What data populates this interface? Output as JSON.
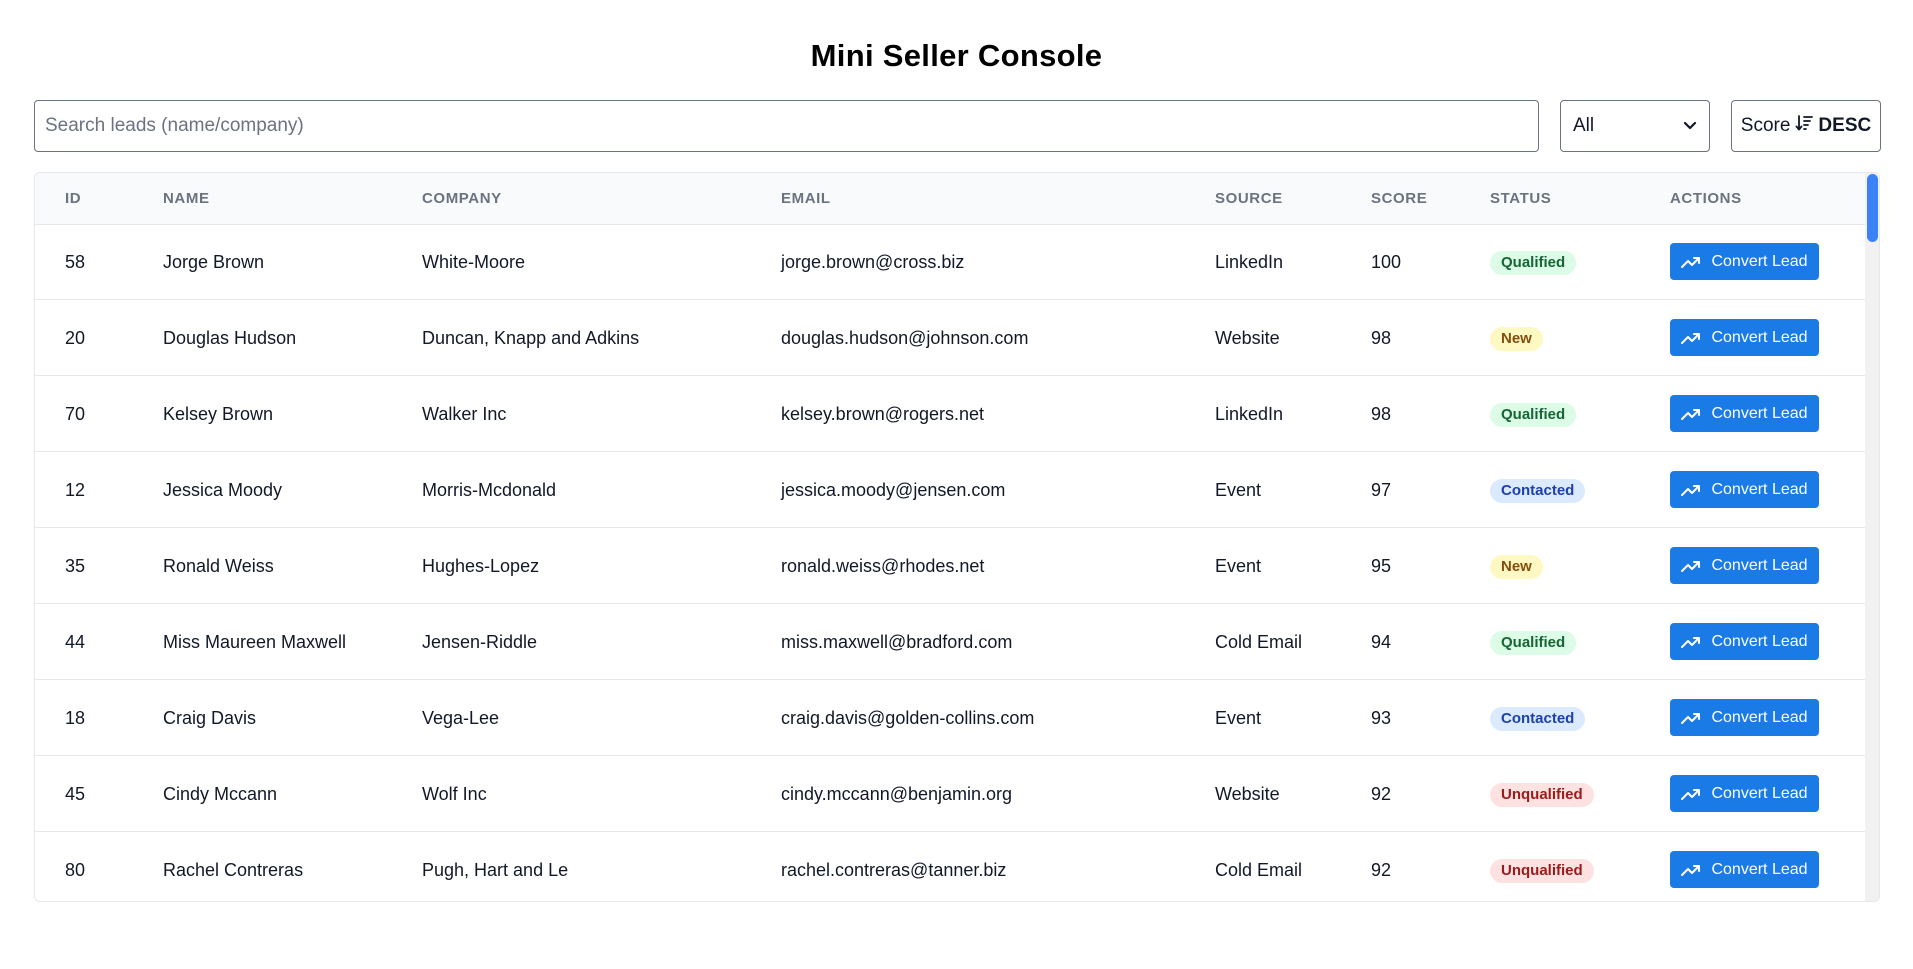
{
  "title": "Mini Seller Console",
  "toolbar": {
    "search_placeholder": "Search leads (name/company)",
    "search_value": "",
    "status_filter": "All",
    "sort_field": "Score",
    "sort_direction": "DESC"
  },
  "table": {
    "headers": [
      "ID",
      "NAME",
      "COMPANY",
      "EMAIL",
      "SOURCE",
      "SCORE",
      "STATUS",
      "ACTIONS"
    ],
    "action_label": "Convert Lead",
    "rows": [
      {
        "id": "58",
        "name": "Jorge Brown",
        "company": "White-Moore",
        "email": "jorge.brown@cross.biz",
        "source": "LinkedIn",
        "score": "100",
        "status": "Qualified"
      },
      {
        "id": "20",
        "name": "Douglas Hudson",
        "company": "Duncan, Knapp and Adkins",
        "email": "douglas.hudson@johnson.com",
        "source": "Website",
        "score": "98",
        "status": "New"
      },
      {
        "id": "70",
        "name": "Kelsey Brown",
        "company": "Walker Inc",
        "email": "kelsey.brown@rogers.net",
        "source": "LinkedIn",
        "score": "98",
        "status": "Qualified"
      },
      {
        "id": "12",
        "name": "Jessica Moody",
        "company": "Morris-Mcdonald",
        "email": "jessica.moody@jensen.com",
        "source": "Event",
        "score": "97",
        "status": "Contacted"
      },
      {
        "id": "35",
        "name": "Ronald Weiss",
        "company": "Hughes-Lopez",
        "email": "ronald.weiss@rhodes.net",
        "source": "Event",
        "score": "95",
        "status": "New"
      },
      {
        "id": "44",
        "name": "Miss Maureen Maxwell",
        "company": "Jensen-Riddle",
        "email": "miss.maxwell@bradford.com",
        "source": "Cold Email",
        "score": "94",
        "status": "Qualified"
      },
      {
        "id": "18",
        "name": "Craig Davis",
        "company": "Vega-Lee",
        "email": "craig.davis@golden-collins.com",
        "source": "Event",
        "score": "93",
        "status": "Contacted"
      },
      {
        "id": "45",
        "name": "Cindy Mccann",
        "company": "Wolf Inc",
        "email": "cindy.mccann@benjamin.org",
        "source": "Website",
        "score": "92",
        "status": "Unqualified"
      },
      {
        "id": "80",
        "name": "Rachel Contreras",
        "company": "Pugh, Hart and Le",
        "email": "rachel.contreras@tanner.biz",
        "source": "Cold Email",
        "score": "92",
        "status": "Unqualified"
      }
    ]
  },
  "colors": {
    "primary": "#1a7ae6",
    "qualified_bg": "#dcfce7",
    "new_bg": "#fef9c3",
    "contacted_bg": "#dbeafe",
    "unqualified_bg": "#fee2e2"
  },
  "icons": {
    "sort": "sort-descending-icon",
    "action": "trending-up-icon",
    "select": "chevron-down-icon"
  }
}
